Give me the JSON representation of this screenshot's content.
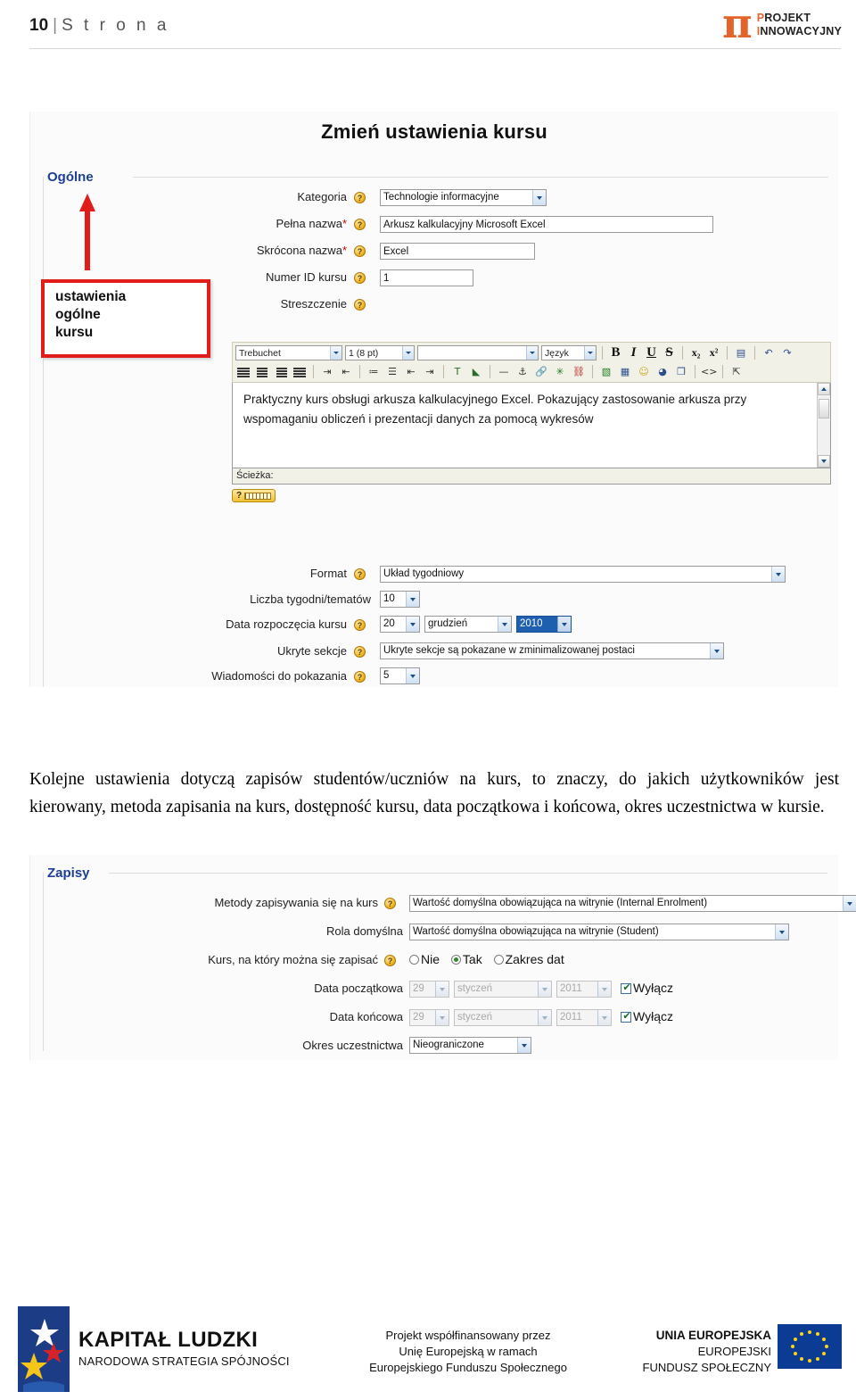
{
  "header": {
    "page_number": "10",
    "separator": "|",
    "page_word": "S t r o n a",
    "brand_pi": "π",
    "brand_line1_cap": "P",
    "brand_line1": "ROJEKT",
    "brand_line2_cap": "I",
    "brand_line2": "NNOWACYJNY"
  },
  "screenshot1": {
    "title": "Zmień ustawienia kursu",
    "legend": "Ogólne",
    "callout": "ustawienia\nogólne\nkursu",
    "fields": {
      "category_label": "Kategoria",
      "category_value": "Technologie informacyjne",
      "fullname_label": "Pełna nazwa",
      "fullname_value": "Arkusz kalkulacyjny Microsoft  Excel",
      "shortname_label": "Skrócona nazwa",
      "shortname_value": "Excel",
      "idnumber_label": "Numer ID kursu",
      "idnumber_value": "1",
      "summary_label": "Streszczenie",
      "format_label": "Format",
      "format_value": "Układ tygodniowy",
      "weeks_label": "Liczba tygodni/tematów",
      "weeks_value": "10",
      "startdate_label": "Data rozpoczęcia kursu",
      "startdate_day": "20",
      "startdate_month": "grudzień",
      "startdate_year": "2010",
      "hidden_label": "Ukryte sekcje",
      "hidden_value": "Ukryte sekcje są pokazane w zminimalizowanej postaci",
      "news_label": "Wiadomości do pokazania",
      "news_value": "5",
      "required_mark": "*"
    },
    "editor": {
      "font_family": "Trebuchet",
      "font_size": "1 (8 pt)",
      "style_blank": "",
      "language": "Język",
      "bold": "B",
      "italic": "I",
      "underline": "U",
      "strike": "S",
      "subscript": "x₂",
      "superscript": "x²",
      "content": "Praktyczny kurs obsługi arkusza kalkulacyjnego Excel. Pokazujący zastosowanie arkusza przy wspomaganiu obliczeń i prezentacji danych za pomocą wykresów",
      "path_label": "Ścieżka:",
      "help_button": "?"
    }
  },
  "paragraph": "Kolejne ustawienia dotyczą zapisów studentów/uczniów na kurs, to znaczy, do jakich użytkowników jest kierowany, metoda zapisania na kurs, dostępność kursu, data początkowa i końcowa, okres uczestnictwa w kursie.",
  "screenshot2": {
    "legend": "Zapisy",
    "enrol_methods_label": "Metody zapisywania się na kurs",
    "enrol_methods_value": "Wartość domyślna obowiązująca na witrynie (Internal Enrolment)",
    "default_role_label": "Rola domyślna",
    "default_role_value": "Wartość domyślna obowiązująca na witrynie (Student)",
    "enrolable_label": "Kurs, na który można się zapisać",
    "enrolable_options": [
      "Nie",
      "Tak",
      "Zakres dat"
    ],
    "enrolable_selected": "Tak",
    "startdate_label": "Data początkowa",
    "startdate_day": "29",
    "startdate_month": "styczeń",
    "startdate_year": "2011",
    "startdate_disable": "Wyłącz",
    "enddate_label": "Data końcowa",
    "enddate_day": "29",
    "enddate_month": "styczeń",
    "enddate_year": "2011",
    "enddate_disable": "Wyłącz",
    "period_label": "Okres uczestnictwa",
    "period_value": "Nieograniczone"
  },
  "footer": {
    "kapital_line1": "KAPITAŁ LUDZKI",
    "kapital_line2": "NARODOWA STRATEGIA SPÓJNOŚCI",
    "middle_line1": "Projekt współfinansowany przez",
    "middle_line2": "Unię Europejską w ramach",
    "middle_line3": "Europejskiego Funduszu Społecznego",
    "eu_line1": "UNIA EUROPEJSKA",
    "eu_line2": "EUROPEJSKI",
    "eu_line3": "FUNDUSZ SPOŁECZNY"
  },
  "colors": {
    "brand_orange": "#E2642A",
    "legend_blue": "#1c3f94",
    "callout_red": "#e21b1b",
    "eu_blue": "#0b3b92",
    "eu_star": "#ffd617"
  }
}
